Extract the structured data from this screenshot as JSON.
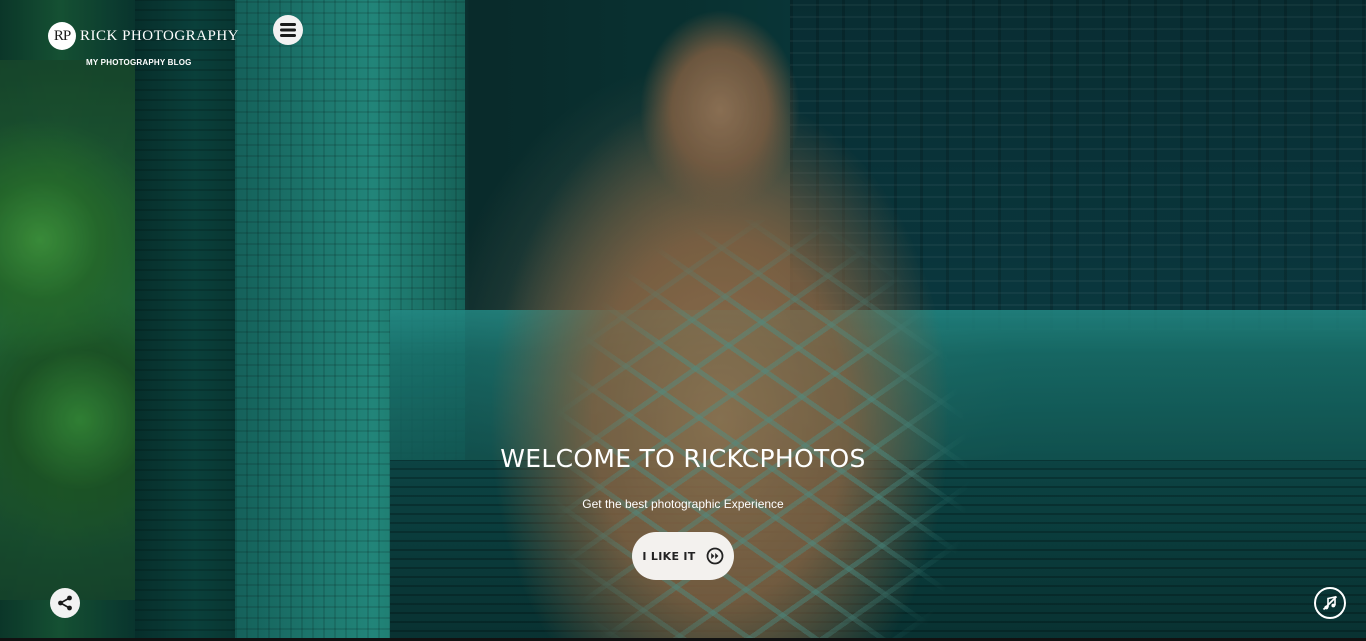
{
  "header": {
    "logo_mark": "RP",
    "logo_text": "RICK PHOTOGRAPHY",
    "tagline": "MY PHOTOGRAPHY BLOG",
    "menu_icon": "hamburger-menu-icon"
  },
  "hero": {
    "headline": "WELCOME TO RICKCPHOTOS",
    "subline": "Get the best photographic Experience",
    "cta_label": "I LIKE IT",
    "cta_icon": "fast-forward-circle-icon"
  },
  "controls": {
    "share_icon": "share-icon",
    "mute_icon": "music-muted-icon"
  },
  "colors": {
    "button_bg": "#f3f1ee",
    "text": "#ffffff",
    "overlay_tint": "#0b3a3a"
  }
}
